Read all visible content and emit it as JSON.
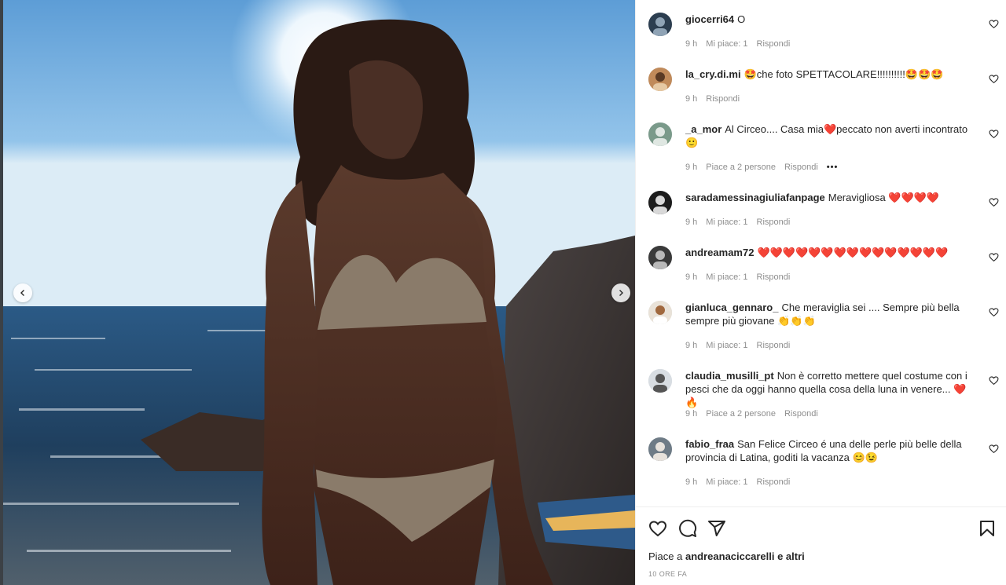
{
  "post": {
    "comments": [
      {
        "user": "giocerri64",
        "text": "O",
        "time": "9 h",
        "likes": "Mi piace: 1",
        "reply": "Rispondi"
      },
      {
        "user": "la_cry.di.mi",
        "text": "🤩che foto SPETTACOLARE!!!!!!!!!!🤩🤩🤩",
        "time": "9 h",
        "likes": "",
        "reply": "Rispondi"
      },
      {
        "user": "_a_mor",
        "text": "Al Circeo.... Casa mia❤️peccato non averti incontrato 🙂",
        "time": "9 h",
        "likes": "Piace a 2 persone",
        "reply": "Rispondi",
        "more": "•••"
      },
      {
        "user": "saradamessinagiuliafanpage",
        "text": "Meravigliosa ❤️❤️❤️❤️",
        "time": "9 h",
        "likes": "Mi piace: 1",
        "reply": "Rispondi"
      },
      {
        "user": "andreamam72",
        "text": "❤️❤️❤️❤️❤️❤️❤️❤️❤️❤️❤️❤️❤️❤️❤️",
        "time": "9 h",
        "likes": "Mi piace: 1",
        "reply": "Rispondi"
      },
      {
        "user": "gianluca_gennaro_",
        "text": "Che meraviglia sei .... Sempre più bella sempre più giovane 👏👏👏",
        "time": "9 h",
        "likes": "Mi piace: 1",
        "reply": "Rispondi"
      },
      {
        "user": "claudia_musilli_pt",
        "text": "Non è corretto mettere quel costume con i pesci che da oggi hanno quella cosa della luna in venere... ❤️🔥",
        "time": "9 h",
        "likes": "Piace a 2 persone",
        "reply": "Rispondi"
      },
      {
        "user": "fabio_fraa",
        "text": "San Felice Circeo é una delle perle più belle della provincia di Latina, goditi la vacanza 😊😉",
        "time": "9 h",
        "likes": "Mi piace: 1",
        "reply": "Rispondi"
      }
    ],
    "likes_prefix": "Piace a",
    "likes_user": "andreanaciccarelli",
    "likes_suffix": "e altri",
    "timestamp": "10 ORE FA"
  },
  "colors": {
    "text": "#262626",
    "muted": "#8e8e8e",
    "border": "#efefef"
  },
  "icons": {
    "prev": "chevron-left-icon",
    "next": "chevron-right-icon",
    "like": "heart-outline-icon",
    "comment": "speech-bubble-icon",
    "share": "paper-plane-icon",
    "save": "bookmark-icon"
  }
}
